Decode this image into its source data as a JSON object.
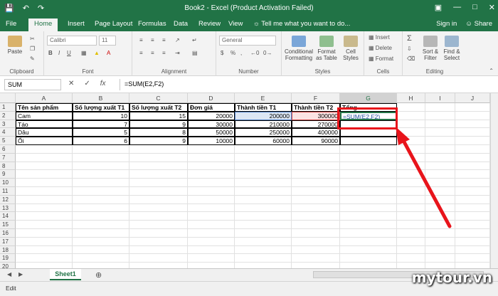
{
  "window": {
    "title": "Book2 - Excel (Product Activation Failed)",
    "save_icon": "save-icon",
    "undo_icon": "undo-icon",
    "redo_icon": "redo-icon"
  },
  "ribbon_tabs": [
    "File",
    "Home",
    "Insert",
    "Page Layout",
    "Formulas",
    "Data",
    "Review",
    "View"
  ],
  "tell_me": "Tell me what you want to do...",
  "sign_in": "Sign in",
  "share": "Share",
  "ribbon": {
    "clipboard": {
      "label": "Clipboard",
      "paste": "Paste"
    },
    "font": {
      "label": "Font",
      "font_name": "Calibri",
      "font_size": "11",
      "bold": "B",
      "italic": "I",
      "underline": "U"
    },
    "alignment": {
      "label": "Alignment"
    },
    "number": {
      "label": "Number",
      "format": "General"
    },
    "styles": {
      "label": "Styles",
      "conditional": "Conditional Formatting",
      "format_table": "Format as Table",
      "cell_styles": "Cell Styles"
    },
    "cells": {
      "label": "Cells",
      "insert": "Insert",
      "delete": "Delete",
      "format": "Format"
    },
    "editing": {
      "label": "Editing",
      "sort": "Sort & Filter",
      "find": "Find & Select"
    }
  },
  "formula_bar": {
    "name_box": "SUM",
    "fx": "fx",
    "formula": "=SUM(E2,F2)"
  },
  "columns": [
    "A",
    "B",
    "C",
    "D",
    "E",
    "F",
    "G",
    "H",
    "I",
    "J"
  ],
  "rows": [
    "1",
    "2",
    "3",
    "4",
    "5",
    "6",
    "7",
    "8",
    "9",
    "10",
    "11",
    "12",
    "13",
    "14",
    "15",
    "16",
    "17",
    "18",
    "19",
    "20"
  ],
  "table": {
    "headers": [
      "Tên sản phẩm",
      "Số lượng xuất T1",
      "Số lượng xuất T2",
      "Đơn giá",
      "Thành tiền T1",
      "Thành tiền T2",
      "Tổng"
    ],
    "data": [
      [
        "Cam",
        "10",
        "15",
        "20000",
        "200000",
        "300000",
        "=SUM(E2,F2)"
      ],
      [
        "Táo",
        "7",
        "9",
        "30000",
        "210000",
        "270000",
        ""
      ],
      [
        "Dâu",
        "5",
        "8",
        "50000",
        "250000",
        "400000",
        ""
      ],
      [
        "Ổi",
        "6",
        "9",
        "10000",
        "60000",
        "90000",
        ""
      ]
    ]
  },
  "sheet_tab": "Sheet1",
  "status": "Edit",
  "watermark": "mytour.vn"
}
